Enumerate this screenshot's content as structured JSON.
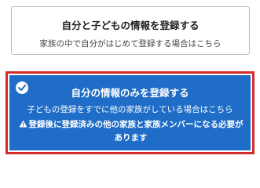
{
  "options": {
    "both": {
      "title": "自分と子どもの情報を登録する",
      "subtitle": "家族の中で自分がはじめて登録する場合はこちら",
      "selected": false
    },
    "self_only": {
      "title": "自分の情報のみを登録する",
      "subtitle": "子どもの登録をすでに他の家族がしている場合はこちら",
      "warning": "登録後に登録済みの他の家族と家族メンバーになる必要があります",
      "selected": true
    }
  },
  "colors": {
    "selected_background": "#1f6dc7",
    "selected_border": "#d42b2b",
    "unselected_border": "#bdbdbd"
  },
  "icons": {
    "selected_marker": "checkmark-circle-icon",
    "warning": "warning-triangle-icon"
  }
}
